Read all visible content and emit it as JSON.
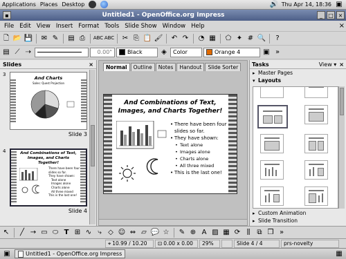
{
  "top_panel": {
    "menus": [
      "Applications",
      "Places",
      "Desktop"
    ],
    "clock": "Thu Apr 14, 18:36"
  },
  "window": {
    "title": "Untitled1 - OpenOffice.org Impress"
  },
  "menubar": {
    "items": [
      "File",
      "Edit",
      "View",
      "Insert",
      "Format",
      "Tools",
      "Slide Show",
      "Window",
      "Help"
    ]
  },
  "line_toolbar": {
    "line_width": "0.00\"",
    "line_color": "Black",
    "area_style": "Color",
    "area_color": "Orange 4",
    "line_color_hex": "#000000",
    "area_color_hex": "#e06a00"
  },
  "slides_pane": {
    "title": "Slides",
    "slides": [
      {
        "number": "3",
        "label": "Slide 3",
        "thumb_title": "And Charts",
        "thumb_subtitle": "Sales: Quest Projection"
      },
      {
        "number": "4",
        "label": "Slide 4",
        "thumb_title": "And Combinations of Text, Images, and Charts Together!",
        "bullets": [
          "There have been four slides so far.",
          "They have shown:",
          "Text alone",
          "Images alone",
          "Charts alone",
          "All three mixed",
          "This is the last one!"
        ]
      }
    ]
  },
  "editor": {
    "tabs": [
      "Normal",
      "Outline",
      "Notes",
      "Handout",
      "Slide Sorter"
    ],
    "slide_title": "And Combinations of Text, Images, and Charts Together!",
    "bullets": [
      {
        "level": 1,
        "text": "There have been four slides so far."
      },
      {
        "level": 1,
        "text": "They have shown:"
      },
      {
        "level": 2,
        "text": "Text alone"
      },
      {
        "level": 2,
        "text": "Images alone"
      },
      {
        "level": 2,
        "text": "Charts alone"
      },
      {
        "level": 2,
        "text": "All three mixed"
      },
      {
        "level": 1,
        "text": "This is the last one!"
      }
    ]
  },
  "tasks_pane": {
    "title": "Tasks",
    "view_label": "View",
    "sections": [
      "Master Pages",
      "Layouts",
      "Custom Animation",
      "Slide Transition"
    ]
  },
  "statusbar": {
    "position": "10.99 / 10.20",
    "size": "0.00 x 0.00",
    "zoom": "29%",
    "slide": "Slide 4 / 4",
    "master": "prs-novelty"
  },
  "taskbar": {
    "window_button": "Untitled1 - OpenOffice.org Impress"
  }
}
